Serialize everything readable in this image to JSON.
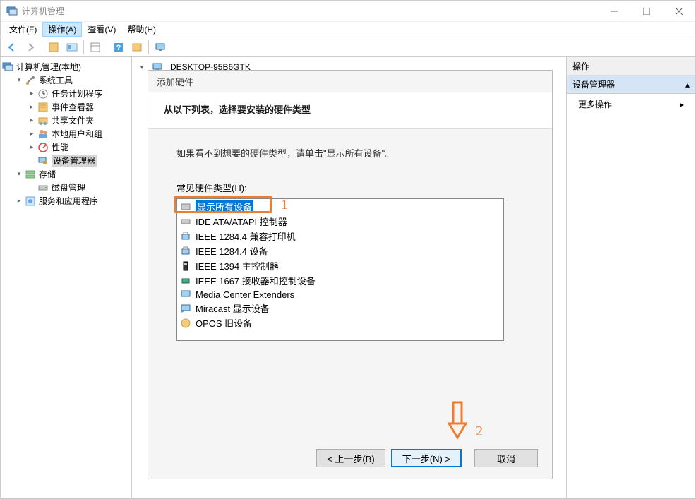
{
  "title": "计算机管理",
  "menu": {
    "file": "文件(F)",
    "action": "操作(A)",
    "view": "查看(V)",
    "help": "帮助(H)"
  },
  "tree": {
    "root": "计算机管理(本地)",
    "system_tools": "系统工具",
    "task_scheduler": "任务计划程序",
    "event_viewer": "事件查看器",
    "shared_folders": "共享文件夹",
    "local_users": "本地用户和组",
    "performance": "性能",
    "device_manager": "设备管理器",
    "storage": "存储",
    "disk_mgmt": "磁盘管理",
    "services_apps": "服务和应用程序"
  },
  "main": {
    "computer_name": "DESKTOP-95B6GTK"
  },
  "actions": {
    "header": "操作",
    "section": "设备管理器",
    "more": "更多操作"
  },
  "dialog": {
    "title": "添加硬件",
    "header": "从以下列表，选择要安装的硬件类型",
    "instruction": "如果看不到想要的硬件类型，请单击\"显示所有设备\"。",
    "listbox_label": "常见硬件类型(H):",
    "items": [
      "显示所有设备",
      "IDE ATA/ATAPI 控制器",
      "IEEE 1284.4 兼容打印机",
      "IEEE 1284.4 设备",
      "IEEE 1394 主控制器",
      "IEEE 1667 接收器和控制设备",
      "Media Center Extenders",
      "Miracast 显示设备",
      "OPOS 旧设备"
    ],
    "btn_back": "< 上一步(B)",
    "btn_next": "下一步(N) >",
    "btn_cancel": "取消"
  },
  "annotations": {
    "num1": "1",
    "num2": "2"
  }
}
